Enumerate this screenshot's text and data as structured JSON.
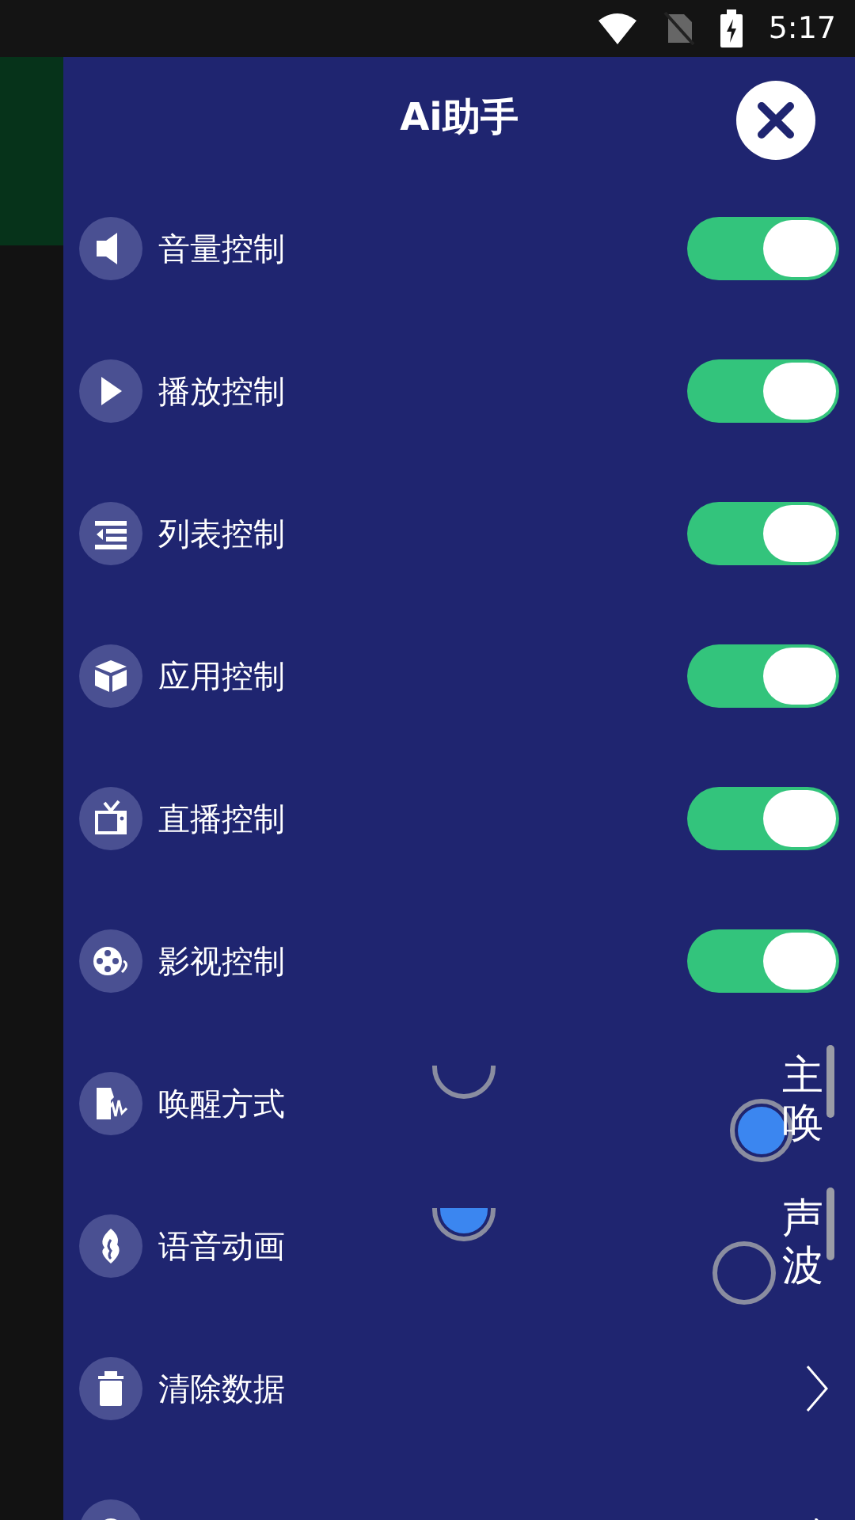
{
  "status_bar": {
    "time": "5:17"
  },
  "drawer": {
    "title": "Ai助手"
  },
  "items": [
    {
      "kind": "switch",
      "label": "音量控制",
      "on": true
    },
    {
      "kind": "switch",
      "label": "播放控制",
      "on": true
    },
    {
      "kind": "switch",
      "label": "列表控制",
      "on": true
    },
    {
      "kind": "switch",
      "label": "应用控制",
      "on": true
    },
    {
      "kind": "switch",
      "label": "直播控制",
      "on": true
    },
    {
      "kind": "switch",
      "label": "影视控制",
      "on": true
    },
    {
      "kind": "plain",
      "label": "唤醒方式"
    },
    {
      "kind": "plain",
      "label": "语音动画"
    },
    {
      "kind": "link",
      "label": "清除数据"
    },
    {
      "kind": "partial"
    }
  ],
  "overlay_radios": [
    {
      "selected": false
    },
    {
      "selected": true
    },
    {
      "selected": true
    },
    {
      "selected": false
    }
  ],
  "vertical_labels": [
    "主唤",
    "声波"
  ]
}
